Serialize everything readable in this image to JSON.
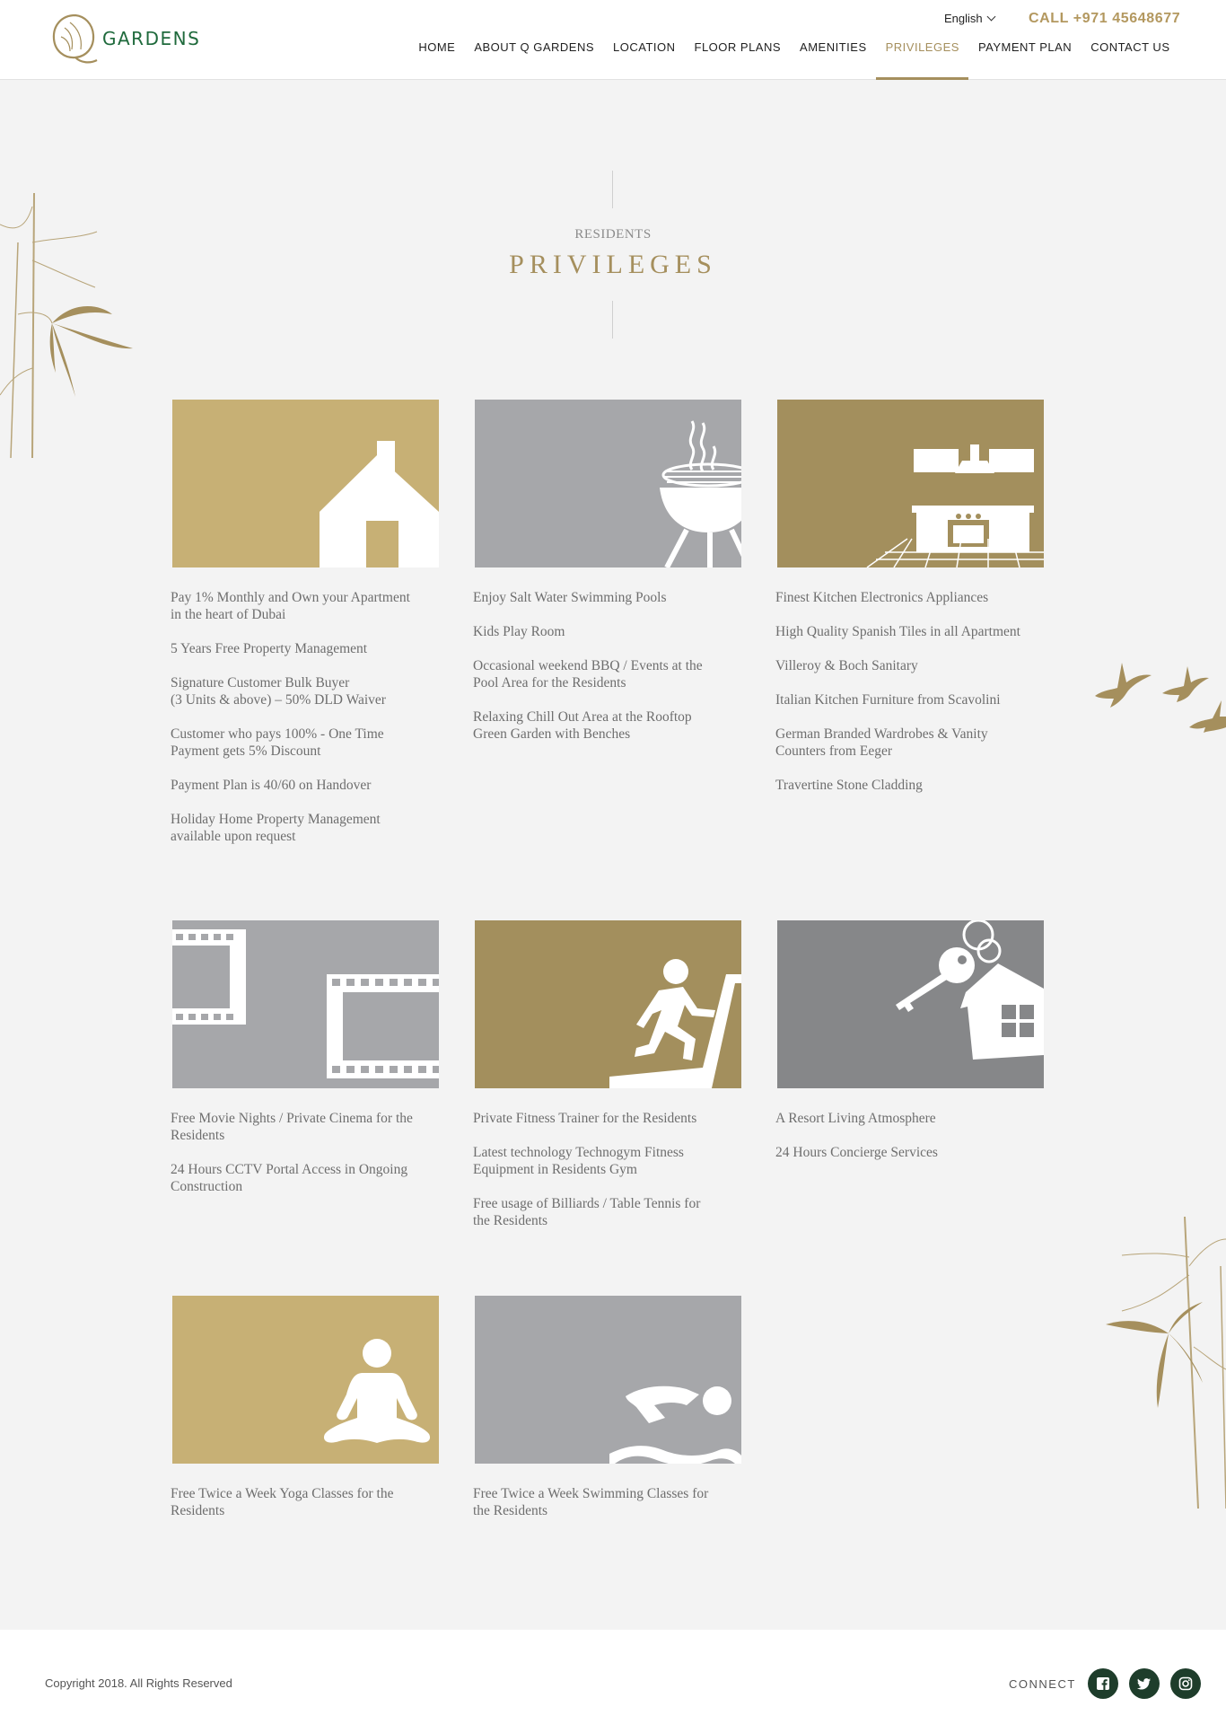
{
  "header": {
    "logo_text": "GARDENS",
    "language": "English",
    "call": "CALL +971 45648677",
    "nav": [
      {
        "label": "HOME"
      },
      {
        "label": "ABOUT Q GARDENS"
      },
      {
        "label": "LOCATION"
      },
      {
        "label": "FLOOR PLANS"
      },
      {
        "label": "AMENITIES"
      },
      {
        "label": "PRIVILEGES",
        "active": true
      },
      {
        "label": "PAYMENT PLAN"
      },
      {
        "label": "CONTACT US"
      }
    ]
  },
  "section": {
    "subtitle": "RESIDENTS",
    "title": "PRIVILEGES"
  },
  "colors": {
    "gold": "#c7b075",
    "olive": "#a38f5d",
    "grey": "#a6a7aa",
    "dark_grey": "#868789",
    "green": "#1f6a3c",
    "accent": "#a58f5d"
  },
  "cards": [
    {
      "icon": "house-icon",
      "items": [
        "Pay 1% Monthly and Own your Apartment\nin the heart of Dubai",
        "5 Years Free Property Management",
        "Signature Customer Bulk Buyer\n(3 Units & above) – 50% DLD Waiver",
        "Customer who pays 100% - One Time\nPayment gets 5% Discount",
        "Payment Plan is 40/60 on Handover",
        "Holiday Home Property Management\navailable upon request"
      ]
    },
    {
      "icon": "bbq-grill-icon",
      "items": [
        "Enjoy Salt Water Swimming Pools",
        "Kids Play Room",
        "Occasional weekend BBQ / Events at the\nPool Area for the Residents",
        "Relaxing Chill Out Area at the Rooftop\nGreen Garden with Benches"
      ]
    },
    {
      "icon": "kitchen-icon",
      "items": [
        "Finest  Kitchen Electronics Appliances",
        "High Quality Spanish Tiles in all Apartment",
        "Villeroy & Boch Sanitary",
        "Italian Kitchen Furniture from Scavolini",
        "German Branded Wardrobes & Vanity\nCounters from Eeger",
        "Travertine Stone Cladding"
      ]
    },
    {
      "icon": "film-reel-icon",
      "items": [
        "Free Movie Nights / Private Cinema for the\nResidents",
        "24 Hours CCTV Portal Access in Ongoing\nConstruction"
      ]
    },
    {
      "icon": "treadmill-runner-icon",
      "items": [
        "Private Fitness Trainer for the Residents",
        "Latest technology Technogym Fitness\nEquipment in Residents Gym",
        "Free usage of Billiards / Table Tennis for\nthe Residents"
      ]
    },
    {
      "icon": "house-keys-icon",
      "items": [
        "A Resort Living Atmosphere",
        "24 Hours Concierge Services"
      ]
    },
    {
      "icon": "yoga-icon",
      "items": [
        "Free Twice a Week Yoga Classes for the\nResidents"
      ]
    },
    {
      "icon": "swimmer-icon",
      "items": [
        "Free Twice a Week Swimming Classes for\nthe Residents"
      ]
    }
  ],
  "footer": {
    "copyright": "Copyright 2018. All Rights Reserved",
    "connect": "CONNECT",
    "social": [
      "facebook-icon",
      "twitter-icon",
      "instagram-icon"
    ]
  }
}
